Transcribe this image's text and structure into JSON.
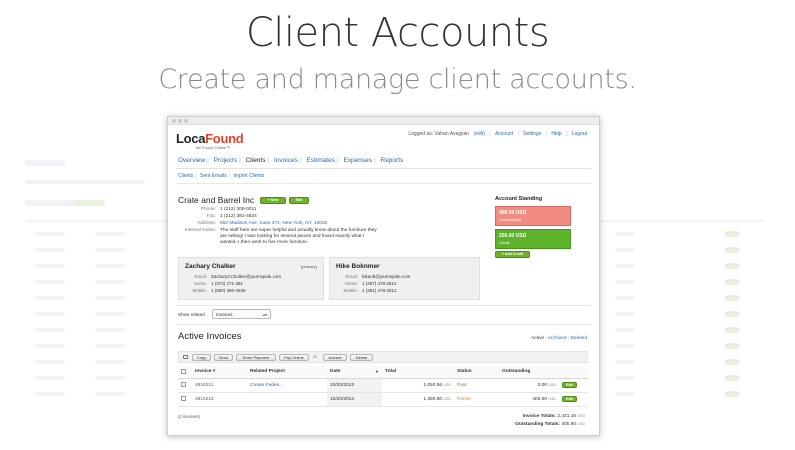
{
  "hero": {
    "title": "Client Accounts",
    "subtitle": "Create and manage client accounts."
  },
  "app": {
    "logo_part1": "Loca",
    "logo_part2": "Found",
    "logo_tagline": "Be Found Online™",
    "topnav": {
      "logged_as": "Logged as: Vahan Avagyan",
      "edit": "(edit)",
      "account": "Account",
      "settings": "Settings",
      "help": "Help",
      "logout": "Logout"
    },
    "mainnav": [
      "Overview",
      "Projects",
      "Clients",
      "Invoices",
      "Estimates",
      "Expenses",
      "Reports"
    ],
    "active_nav": "Clients",
    "subnav": [
      "Clients",
      "Sent Emails",
      "Import Clients"
    ],
    "client": {
      "name": "Crate and Barrel Inc",
      "new_label": "+ New",
      "edit_label": "Edit",
      "phone_label": "Phone:",
      "phone": "1 (212) 308-0011",
      "fax_label": "Fax:",
      "fax": "1 (212) 381-4824",
      "address_label": "Address:",
      "address": "650 Madison Ave, Suite 371, New York, NY, 10022",
      "notes_label": "Internal Notes:",
      "notes_line1": "The staff here are super helpful and actually know about the furniture they",
      "notes_line2": "are selling! I was looking for several pieces and found exactly what I",
      "notes_line3": "wanted. I then went to five more furniture."
    },
    "account_standing": {
      "title": "Account Standing",
      "outstanding_amount": "400.50 USD",
      "outstanding_label": "Outstanding",
      "credit_amount": "250.00 USD",
      "credit_label": "Credit",
      "add_credit": "+ Add Credit",
      "outstanding_color": "#f28b80",
      "credit_color": "#5db32c"
    },
    "contacts": [
      {
        "name": "Zachary Chalker",
        "primary": "(primary)",
        "email_label": "Email:",
        "email": "ZacharyCChalker@journspide.com",
        "home_label": "Home:",
        "home": "1 (373) 271-381",
        "mobile_label": "Mobile:",
        "mobile": "1 (850) 360-4636"
      },
      {
        "name": "Hike Boknmer",
        "email_label": "Email:",
        "email": "bikanb@journspide.com",
        "home_label": "Home:",
        "home": "1 (497) 478-2812",
        "mobile_label": "Mobile:",
        "mobile": "1 (381) 478-2812"
      }
    ],
    "show_related_label": "Show related",
    "show_related_value": "Invoices",
    "invoices": {
      "title": "Active Invoices",
      "filter_active": "Active",
      "filter_archived": "Archived",
      "filter_deleted": "Deleted",
      "toolbar": {
        "copy": "Copy",
        "send": "Send",
        "enter_payment": "Enter Payment",
        "pay_online": "Pay Online",
        "or": "or",
        "archive": "Archive",
        "delete": "Delete"
      },
      "columns": [
        "Invoice #",
        "Related Project",
        "Date",
        "Total",
        "Status",
        "Outstanding"
      ],
      "rows": [
        {
          "invoice": "4816211",
          "project": "Create Fades...",
          "date": "10/20/2013",
          "total": "1,050.56",
          "currency": "USD",
          "status": "Paid",
          "outstanding": "0.00",
          "edit": "Edit"
        },
        {
          "invoice": "4816215",
          "project": "",
          "date": "10/20/2013",
          "total": "1,380.60",
          "currency": "USD",
          "status": "Partial",
          "outstanding": "405.60",
          "edit": "Edit"
        }
      ],
      "count": "(2 invoices)",
      "invoice_totals_label": "Invoice Totals:",
      "invoice_totals": "2,431.16",
      "outstanding_totals_label": "Outstanding Totals:",
      "outstanding_totals": "405.60",
      "totals_currency": "USD"
    }
  }
}
